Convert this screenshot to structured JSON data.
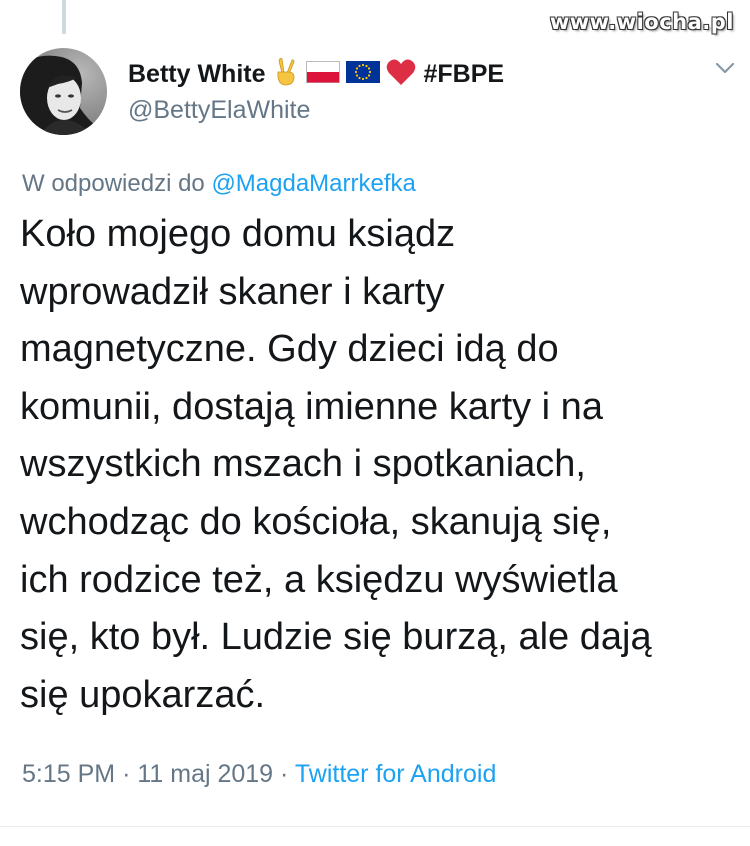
{
  "watermark": "www.wiocha.pl",
  "author": {
    "display_name": "Betty White",
    "hashtag": "#FBPE",
    "handle": "@BettyElaWhite",
    "emoji_icons": [
      "victory-hand-icon",
      "poland-flag-icon",
      "eu-flag-icon",
      "red-heart-icon"
    ]
  },
  "reply": {
    "prefix": "W odpowiedzi do",
    "mention": "@MagdaMarrkefka"
  },
  "tweet": {
    "lines": [
      "Koło mojego domu ksiądz",
      "wprowadził skaner i karty",
      "magnetyczne. Gdy dzieci idą do",
      "komunii, dostają imienne karty i na",
      "wszystkich mszach i spotkaniach,",
      "wchodząc do kościoła, skanują się,",
      "ich rodzice też, a księdzu wyświetla",
      "się, kto był. Ludzie się burzą, ale dają",
      "się upokarzać."
    ]
  },
  "meta": {
    "time": "5:15 PM",
    "separator": "·",
    "date": "11 maj 2019",
    "source": "Twitter for Android"
  },
  "colors": {
    "text": "#14171a",
    "secondary": "#657786",
    "link": "#1da1f2"
  }
}
